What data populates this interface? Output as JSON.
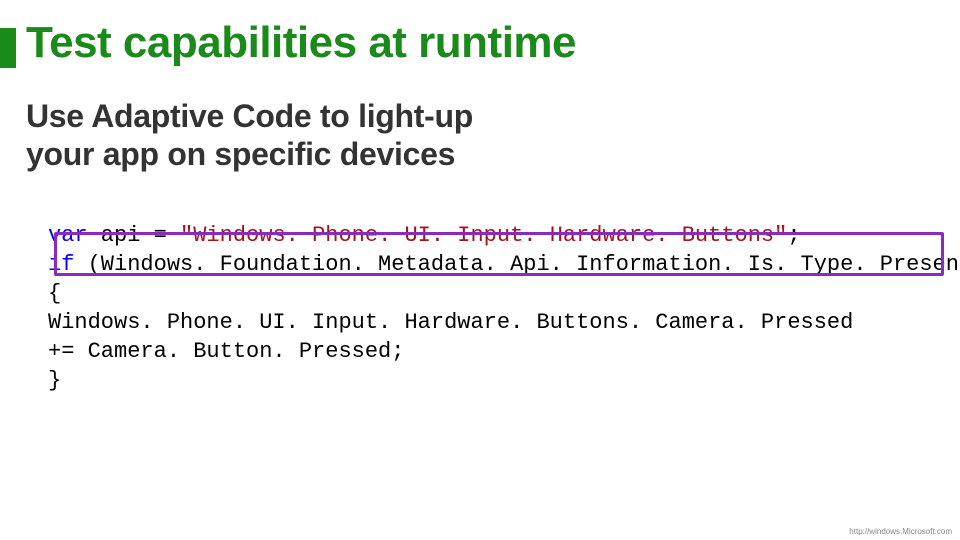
{
  "slide": {
    "title": "Test capabilities at runtime",
    "subtitle_line1": "Use Adaptive Code to light-up",
    "subtitle_line2": "your app on specific devices"
  },
  "code": {
    "kw_var": "var",
    "var_name": " api = ",
    "str_literal": "\"Windows. Phone. UI. Input. Hardware. Buttons\"",
    "semi": ";",
    "kw_if": "if",
    "if_cond": " (Windows. Foundation. Metadata. Api. Information. Is. Type. Present(api))",
    "brace_open": "{",
    "body_line1": "    Windows. Phone. UI. Input. Hardware. Buttons. Camera. Pressed",
    "body_line2": "        += Camera. Button. Pressed;",
    "brace_close": "}"
  },
  "colors": {
    "accent": "#1a8a1a",
    "highlight_border": "#8b2abf",
    "keyword": "#0000ff",
    "string": "#a31515"
  },
  "footer": {
    "url": "http://windows.Microsoft.com"
  }
}
